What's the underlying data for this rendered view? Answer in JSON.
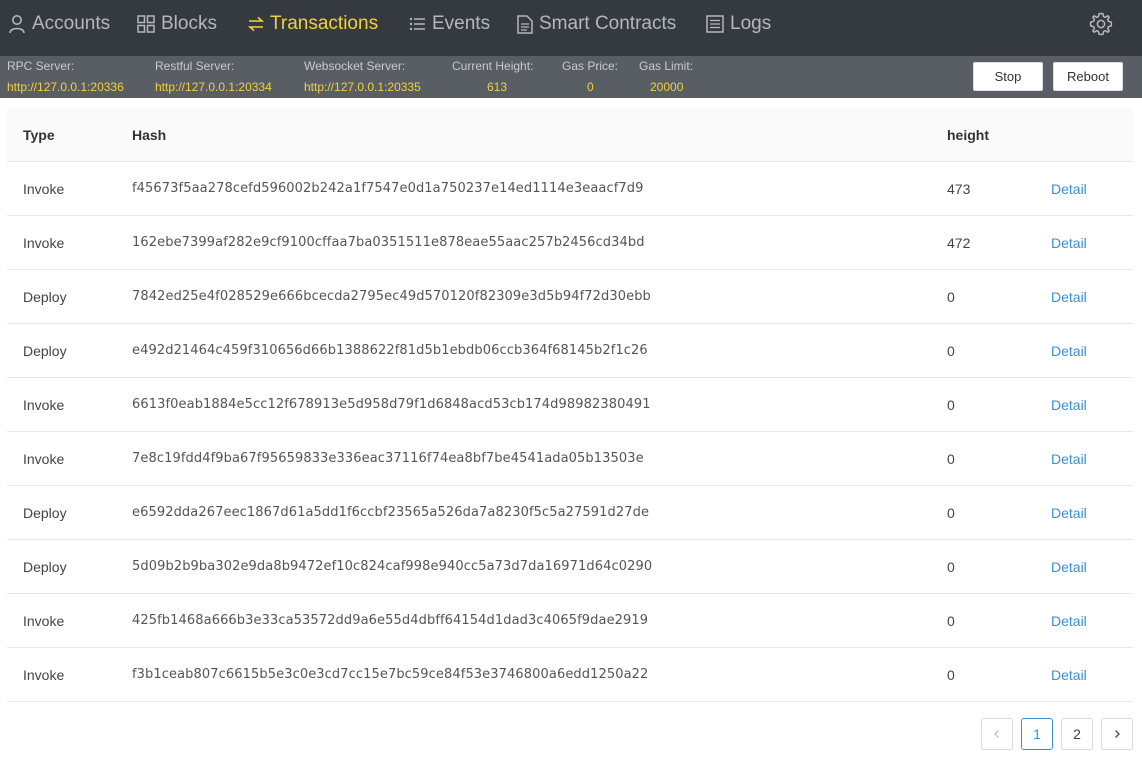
{
  "nav": {
    "items": [
      {
        "label": "Accounts",
        "icon": "user-icon"
      },
      {
        "label": "Blocks",
        "icon": "grid-icon"
      },
      {
        "label": "Transactions",
        "icon": "swap-icon"
      },
      {
        "label": "Events",
        "icon": "list-icon"
      },
      {
        "label": "Smart Contracts",
        "icon": "document-icon"
      },
      {
        "label": "Logs",
        "icon": "log-icon"
      }
    ],
    "active": "Transactions",
    "settings_icon": "gear-icon"
  },
  "status": {
    "rpc_label": "RPC Server:",
    "rpc_value": "http://127.0.0.1:20336",
    "restful_label": "Restful Server:",
    "restful_value": "http://127.0.0.1:20334",
    "websocket_label": "Websocket Server:",
    "websocket_value": "http://127.0.0.1:20335",
    "height_label": "Current Height:",
    "height_value": "613",
    "gas_price_label": "Gas Price:",
    "gas_price_value": "0",
    "gas_limit_label": "Gas Limit:",
    "gas_limit_value": "20000",
    "stop_label": "Stop",
    "reboot_label": "Reboot"
  },
  "table": {
    "headers": {
      "type": "Type",
      "hash": "Hash",
      "height": "height"
    },
    "rows": [
      {
        "type": "Invoke",
        "hash": "f45673f5aa278cefd596002b242a1f7547e0d1a750237e14ed1114e3eaacf7d9",
        "height": "473",
        "action": "Detail"
      },
      {
        "type": "Invoke",
        "hash": "162ebe7399af282e9cf9100cffaa7ba0351511e878eae55aac257b2456cd34bd",
        "height": "472",
        "action": "Detail"
      },
      {
        "type": "Deploy",
        "hash": "7842ed25e4f028529e666bcecda2795ec49d570120f82309e3d5b94f72d30ebb",
        "height": "0",
        "action": "Detail"
      },
      {
        "type": "Deploy",
        "hash": "e492d21464c459f310656d66b1388622f81d5b1ebdb06ccb364f68145b2f1c26",
        "height": "0",
        "action": "Detail"
      },
      {
        "type": "Invoke",
        "hash": "6613f0eab1884e5cc12f678913e5d958d79f1d6848acd53cb174d98982380491",
        "height": "0",
        "action": "Detail"
      },
      {
        "type": "Invoke",
        "hash": "7e8c19fdd4f9ba67f95659833e336eac37116f74ea8bf7be4541ada05b13503e",
        "height": "0",
        "action": "Detail"
      },
      {
        "type": "Deploy",
        "hash": "e6592dda267eec1867d61a5dd1f6ccbf23565a526da7a8230f5c5a27591d27de",
        "height": "0",
        "action": "Detail"
      },
      {
        "type": "Deploy",
        "hash": "5d09b2b9ba302e9da8b9472ef10c824caf998e940cc5a73d7da16971d64c0290",
        "height": "0",
        "action": "Detail"
      },
      {
        "type": "Invoke",
        "hash": "425fb1468a666b3e33ca53572dd9a6e55d4dbff64154d1dad3c4065f9dae2919",
        "height": "0",
        "action": "Detail"
      },
      {
        "type": "Invoke",
        "hash": "f3b1ceab807c6615b5e3c0e3cd7cc15e7bc59ce84f53e3746800a6edd1250a22",
        "height": "0",
        "action": "Detail"
      }
    ]
  },
  "pagination": {
    "prev_icon": "chevron-left-icon",
    "pages": [
      "1",
      "2"
    ],
    "current": "1",
    "next_icon": "chevron-right-icon"
  },
  "colors": {
    "nav_bg": "#353a40",
    "status_bg": "#595e65",
    "accent": "#f3d03e",
    "link": "#3b8fd6"
  }
}
